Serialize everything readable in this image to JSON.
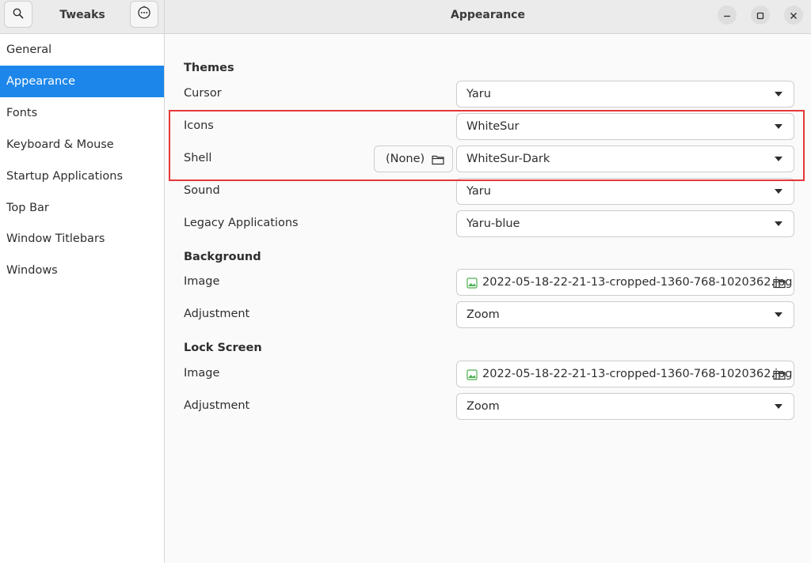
{
  "app_title": "Tweaks",
  "page_title": "Appearance",
  "icons": {
    "search": "search-icon",
    "menu": "menu-icon",
    "minimize": "minimize-icon",
    "maximize": "maximize-icon",
    "close": "close-icon",
    "folder": "folder-icon",
    "image": "image-icon",
    "dropdown": "chevron-down-icon"
  },
  "colors": {
    "accent": "#1c86ea",
    "highlight": "#e5383b"
  },
  "sidebar": {
    "items": [
      {
        "label": "General"
      },
      {
        "label": "Appearance",
        "active": true
      },
      {
        "label": "Fonts"
      },
      {
        "label": "Keyboard & Mouse"
      },
      {
        "label": "Startup Applications"
      },
      {
        "label": "Top Bar"
      },
      {
        "label": "Window Titlebars"
      },
      {
        "label": "Windows"
      }
    ]
  },
  "themes": {
    "heading": "Themes",
    "cursor": {
      "label": "Cursor",
      "value": "Yaru"
    },
    "icons": {
      "label": "Icons",
      "value": "WhiteSur"
    },
    "shell": {
      "label": "Shell",
      "file_value": "(None)",
      "value": "WhiteSur-Dark"
    },
    "sound": {
      "label": "Sound",
      "value": "Yaru"
    },
    "legacy": {
      "label": "Legacy Applications",
      "value": "Yaru-blue"
    }
  },
  "background": {
    "heading": "Background",
    "image": {
      "label": "Image",
      "value": "2022-05-18-22-21-13-cropped-1360-768-1020362.jpg"
    },
    "adjustment": {
      "label": "Adjustment",
      "value": "Zoom"
    }
  },
  "lock_screen": {
    "heading": "Lock Screen",
    "image": {
      "label": "Image",
      "value": "2022-05-18-22-21-13-cropped-1360-768-1020362.jpg"
    },
    "adjustment": {
      "label": "Adjustment",
      "value": "Zoom"
    }
  }
}
